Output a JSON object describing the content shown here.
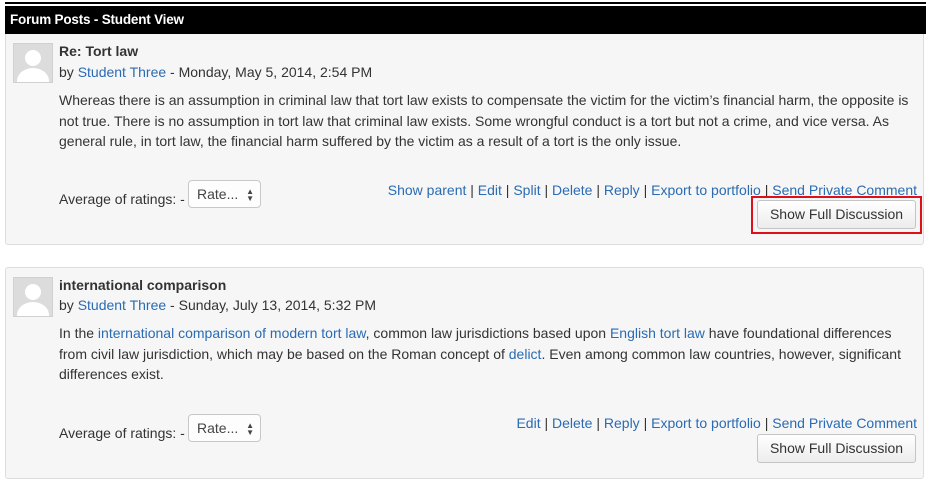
{
  "header": {
    "title": "Forum Posts - Student View"
  },
  "posts": [
    {
      "subject": "Re: Tort law",
      "by": "by ",
      "author": "Student Three",
      "date": " - Monday, May 5, 2014, 2:54 PM",
      "content": "Whereas there is an assumption in criminal law that tort law exists to compensate the victim for the victim’s financial harm, the opposite is not true. There is no assumption in tort law that criminal law exists. Some wrongful conduct is a tort but not a crime, and vice versa. As general rule, in tort law, the financial harm suffered by the victim as a result of a tort is the only issue.",
      "rating_label": "Average of ratings: -",
      "rating_select": "Rate...",
      "commands": [
        "Show parent",
        "Edit",
        "Split",
        "Delete",
        "Reply",
        "Export to portfolio",
        "Send Private Comment"
      ],
      "button": "Show Full Discussion"
    },
    {
      "subject": "international comparison",
      "by": "by ",
      "author": "Student Three",
      "date": " - Sunday, July 13, 2014, 5:32 PM",
      "content_parts": {
        "t1": "In the ",
        "l1": "international comparison of modern tort law",
        "t2": ", common law jurisdictions based upon ",
        "l2": "English tort law",
        "t3": " have foundational differences from civil law jurisdiction, which may be based on the Roman concept of ",
        "l3": "delict",
        "t4": ". Even among common law countries, however, significant differences exist."
      },
      "rating_label": "Average of ratings: -",
      "rating_select": "Rate...",
      "commands": [
        "Edit",
        "Delete",
        "Reply",
        "Export to portfolio",
        "Send Private Comment"
      ],
      "button": "Show Full Discussion"
    }
  ],
  "separator": " | ",
  "colors": {
    "link": "#2a6bb3",
    "header_bg": "#000000",
    "highlight": "#e0101a"
  }
}
